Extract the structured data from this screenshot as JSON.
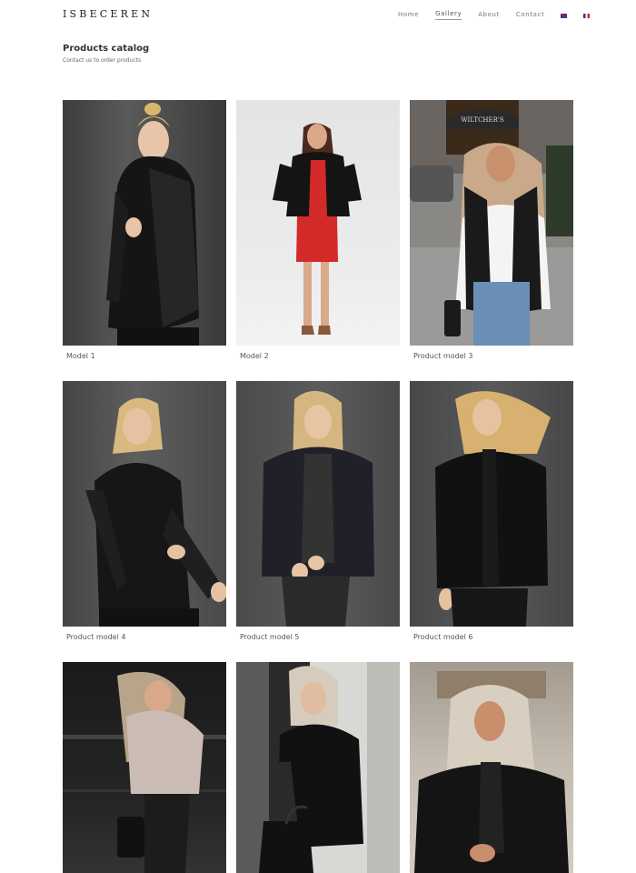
{
  "header": {
    "logo": "ISBECEREN",
    "nav": [
      {
        "label": "Home",
        "active": false
      },
      {
        "label": "Gallery",
        "active": true
      },
      {
        "label": "About",
        "active": false
      },
      {
        "label": "Contact",
        "active": false
      }
    ],
    "languages": [
      "en-flag-icon",
      "fr-flag-icon"
    ]
  },
  "page": {
    "title": "Products catalog",
    "subtitle": "Contact us to order products"
  },
  "products": [
    {
      "caption": "Model 1"
    },
    {
      "caption": "Model 2"
    },
    {
      "caption": "Product model 3"
    },
    {
      "caption": "Product model 4"
    },
    {
      "caption": "Product model 5"
    },
    {
      "caption": "Product model 6"
    },
    {
      "caption": ""
    },
    {
      "caption": ""
    },
    {
      "caption": ""
    }
  ],
  "colors": {
    "background": "#ffffff",
    "text": "#333333",
    "nav_text": "#777777"
  }
}
